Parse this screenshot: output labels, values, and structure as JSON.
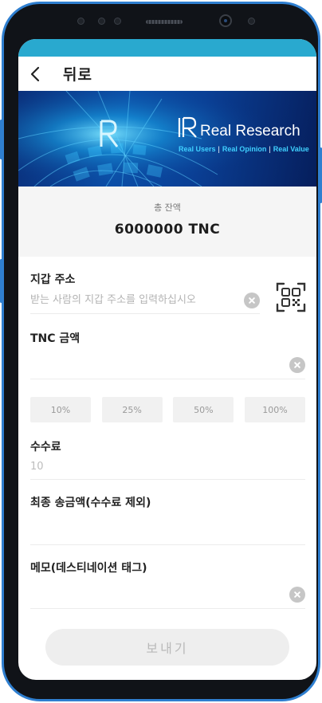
{
  "header": {
    "back_label": "뒤로"
  },
  "banner": {
    "brand_name": "Real Research",
    "taglines": [
      "Real Users",
      "Real Opinion",
      "Real Value"
    ],
    "accent_color": "#3fd0ff"
  },
  "balance": {
    "label": "총 잔액",
    "value": "6000000 TNC"
  },
  "wallet": {
    "label": "지갑 주소",
    "value": "",
    "placeholder": "받는 사람의 지갑 주소를 입력하십시오"
  },
  "amount": {
    "label": "TNC 금액",
    "value": "",
    "placeholder": ""
  },
  "percent_buttons": [
    "10%",
    "25%",
    "50%",
    "100%"
  ],
  "fee": {
    "label": "수수료",
    "value": "10"
  },
  "final_amount": {
    "label": "최종 송금액(수수료 제외)",
    "value": ""
  },
  "memo": {
    "label": "메모(데스티네이션 태그)",
    "value": "",
    "placeholder": ""
  },
  "send_button_label": "보내기",
  "icons": {
    "back": "chevron-left-icon",
    "clear": "clear-icon",
    "qr": "qr-scan-icon"
  },
  "colors": {
    "phone_frame": "#2f7fd0",
    "status_strip": "#29a9cf",
    "banner": "#0b4fa8"
  }
}
